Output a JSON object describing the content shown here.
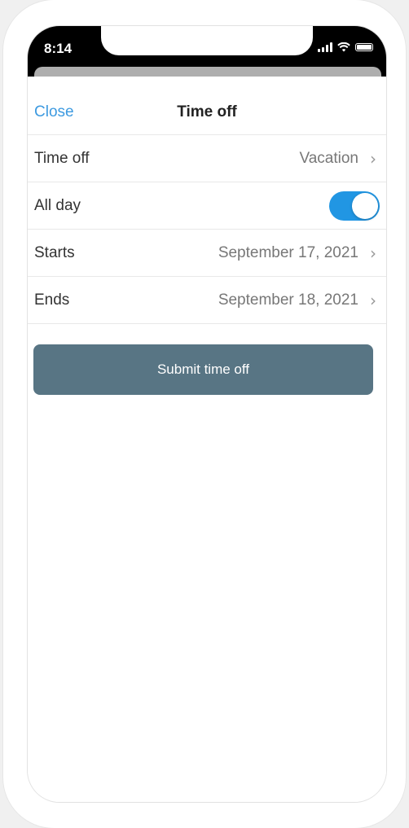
{
  "status_bar": {
    "time": "8:14"
  },
  "nav": {
    "close_label": "Close",
    "title": "Time off"
  },
  "form": {
    "rows": [
      {
        "label": "Time off",
        "value": "Vacation"
      },
      {
        "label": "All day",
        "toggle_on": true
      },
      {
        "label": "Starts",
        "value": "September 17, 2021"
      },
      {
        "label": "Ends",
        "value": "September 18, 2021"
      }
    ]
  },
  "submit_label": "Submit time off",
  "colors": {
    "accent": "#3d9ae0",
    "toggle_on": "#2196e3",
    "submit_bg": "#587584"
  },
  "icons": [
    "signal-icon",
    "wifi-icon",
    "battery-icon",
    "chevron-right-icon"
  ]
}
